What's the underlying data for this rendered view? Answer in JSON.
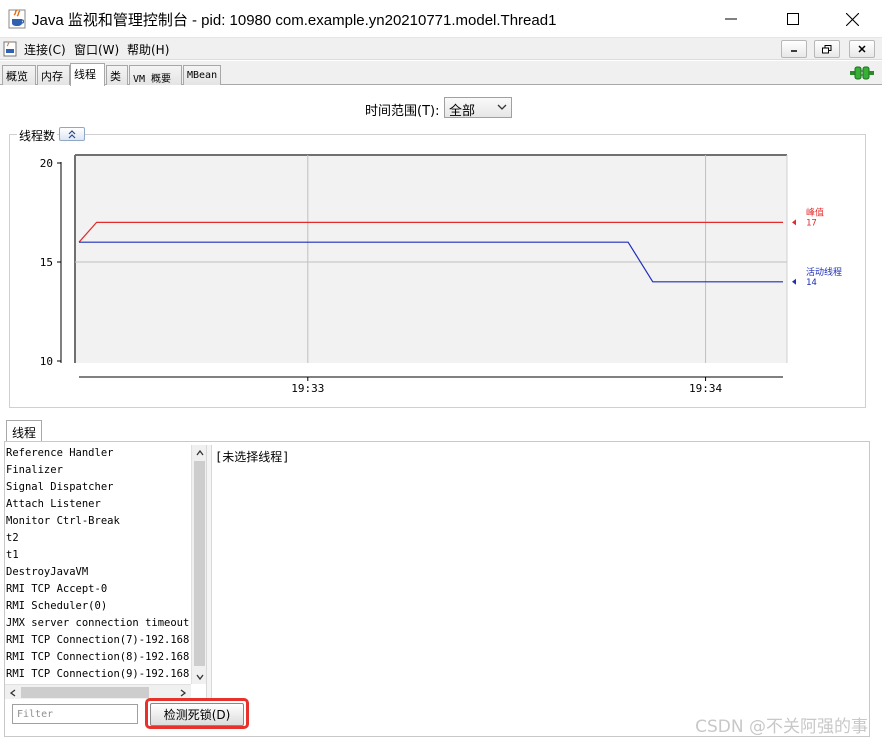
{
  "window": {
    "title": "Java 监视和管理控制台 - pid: 10980 com.example.yn20210771.model.Thread1"
  },
  "menu": {
    "items": [
      "连接(C)",
      "窗口(W)",
      "帮助(H)"
    ]
  },
  "tabs": [
    "概览",
    "内存",
    "线程",
    "类",
    "VM 概要",
    "MBean"
  ],
  "active_tab": "线程",
  "time_range": {
    "label": "时间范围(T):",
    "value": "全部"
  },
  "chart_panel": {
    "title": "线程数"
  },
  "chart_data": {
    "type": "line",
    "title": "线程数",
    "ylim": [
      10,
      20
    ],
    "yticks": [
      "20",
      "15",
      "10"
    ],
    "xticks": [
      "19:33",
      "19:34"
    ],
    "grid": true,
    "series": [
      {
        "name": "峰值",
        "color": "#e32b2b",
        "current": "17",
        "points": [
          [
            0,
            16
          ],
          [
            0.025,
            17
          ],
          [
            1.0,
            17
          ]
        ]
      },
      {
        "name": "活动线程",
        "color": "#1e2fb8",
        "current": "14",
        "points": [
          [
            0,
            16
          ],
          [
            0.78,
            16
          ],
          [
            0.815,
            14
          ],
          [
            1.0,
            14
          ]
        ]
      }
    ]
  },
  "threads": {
    "tab_label": "线程",
    "list": [
      "Reference Handler",
      "Finalizer",
      "Signal Dispatcher",
      "Attach Listener",
      "Monitor Ctrl-Break",
      "t2",
      "t1",
      "DestroyJavaVM",
      "RMI TCP Accept-0",
      "RMI Scheduler(0)",
      "JMX server connection timeout",
      "RMI TCP Connection(7)-192.168.",
      "RMI TCP Connection(8)-192.168.",
      "RMI TCP Connection(9)-192.168."
    ],
    "detail_text": "[未选择线程]",
    "filter_placeholder": "Filter",
    "detect_deadlock_label": "检测死锁(D)"
  },
  "watermark": "CSDN @不关阿强的事",
  "colors": {
    "highlight": "#e8312a",
    "peak_line": "#e32b2b",
    "live_line": "#1e2fb8"
  },
  "icons": [
    "java-app-icon",
    "minimize-icon",
    "maximize-icon",
    "close-icon",
    "document-icon",
    "connected-plug-icon",
    "collapse-up-icon",
    "scroll-up-icon",
    "scroll-down-icon",
    "scroll-left-icon",
    "scroll-right-icon",
    "dropdown-arrow-icon"
  ]
}
